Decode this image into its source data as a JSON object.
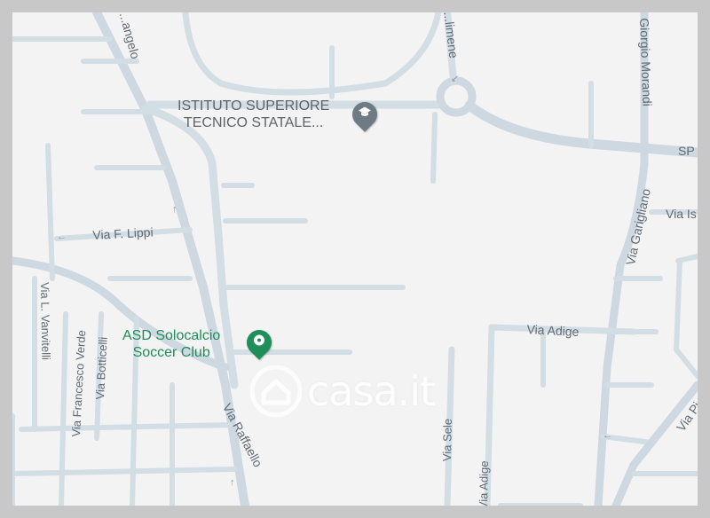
{
  "map": {
    "streets": {
      "angelo": "...angelo",
      "fillimene": "...limene",
      "morandi": "Giorgio Morandi",
      "sp": "SP",
      "lippi": "Via F. Lippi",
      "vanvitelli": "Via L. Vanvitelli",
      "francesco_verde": "Via Francesco Verde",
      "botticelli": "Via Botticelli",
      "raffaello": "Via Raffaello",
      "gargliano": "Via Garigliano",
      "isonzo": "Via Is...",
      "adige_1": "Via Adige",
      "adige_2": "Via Adige",
      "sele": "Via Sele",
      "pi": "Via Pi..."
    },
    "pois": {
      "school_line1": "ISTITUTO SUPERIORE",
      "school_line2": "TECNICO STATALE...",
      "school_icon": "graduation-cap-icon",
      "sport_line1": "ASD Solocalcio",
      "sport_line2": "Soccer Club",
      "sport_icon": "soccer-ball-icon"
    },
    "watermark": "casa.it",
    "colors": {
      "background": "#f3f3f3",
      "road": "#d3dde4",
      "school_pin": "#6e7a84",
      "sport_pin": "#1e8e5a"
    }
  }
}
